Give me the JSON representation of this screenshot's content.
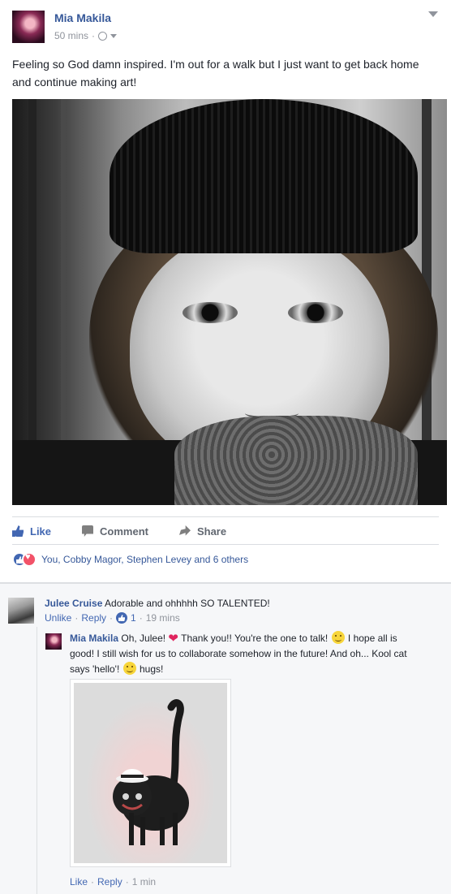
{
  "post": {
    "author": "Mia Makila",
    "time": "50 mins",
    "separator": "·",
    "text": "Feeling so God damn inspired. I'm out for a walk but I just want to get back home and continue making art!",
    "actions": {
      "like": "Like",
      "comment": "Comment",
      "share": "Share"
    },
    "reactions_summary": "You, Cobby Magor, Stephen Levey and 6 others"
  },
  "comments": [
    {
      "author": "Julee Cruise",
      "text": "Adorable and ohhhhh SO TALENTED!",
      "unlike": "Unlike",
      "reply": "Reply",
      "likes": "1",
      "time": "19 mins"
    }
  ],
  "reply": {
    "author": "Mia Makila",
    "text_1": "Oh, Julee!",
    "text_2": "Thank you!! You're the one to talk!",
    "text_3": "I hope all is good! I still wish for us to collaborate somehow in the future! And oh... Kool cat says 'hello'!",
    "text_4": "hugs!",
    "like": "Like",
    "reply": "Reply",
    "time": "1 min"
  },
  "icons": [
    "globe-icon",
    "caret-down-icon",
    "like-icon",
    "comment-icon",
    "share-icon",
    "love-reaction-icon",
    "heart-icon",
    "smile-emoji"
  ],
  "colors": {
    "link": "#365899",
    "accent": "#4267b2",
    "love": "#f25268",
    "muted": "#90949c"
  }
}
